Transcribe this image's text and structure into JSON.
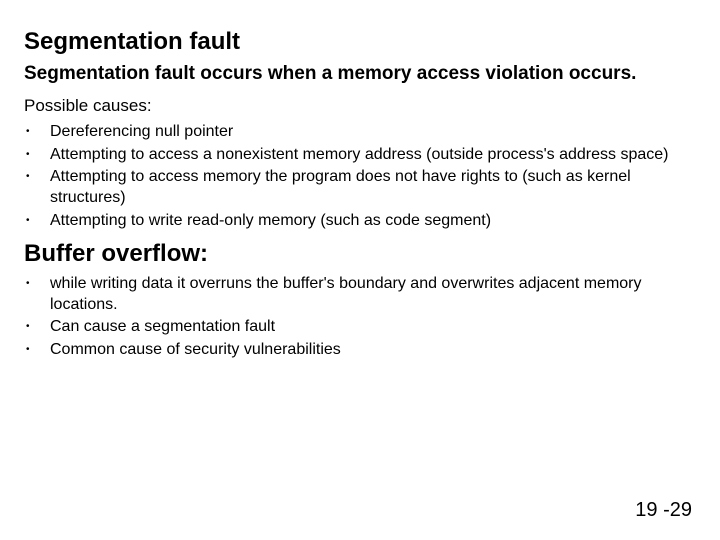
{
  "title": "Segmentation fault",
  "subtitle": "Segmentation fault occurs when a memory access violation occurs.",
  "causes_label": "Possible causes:",
  "causes": [
    "Dereferencing null pointer",
    "Attempting to access a nonexistent memory address (outside process's address space)",
    "Attempting to access memory the program does not have rights to (such as kernel structures)",
    "Attempting to write read-only memory (such as code segment)"
  ],
  "section2_title": "Buffer overflow:",
  "section2_items": [
    "while writing data it overruns the buffer's boundary and overwrites adjacent memory locations.",
    "Can cause a segmentation fault",
    "Common cause of security vulnerabilities"
  ],
  "page_number": "19 -29"
}
